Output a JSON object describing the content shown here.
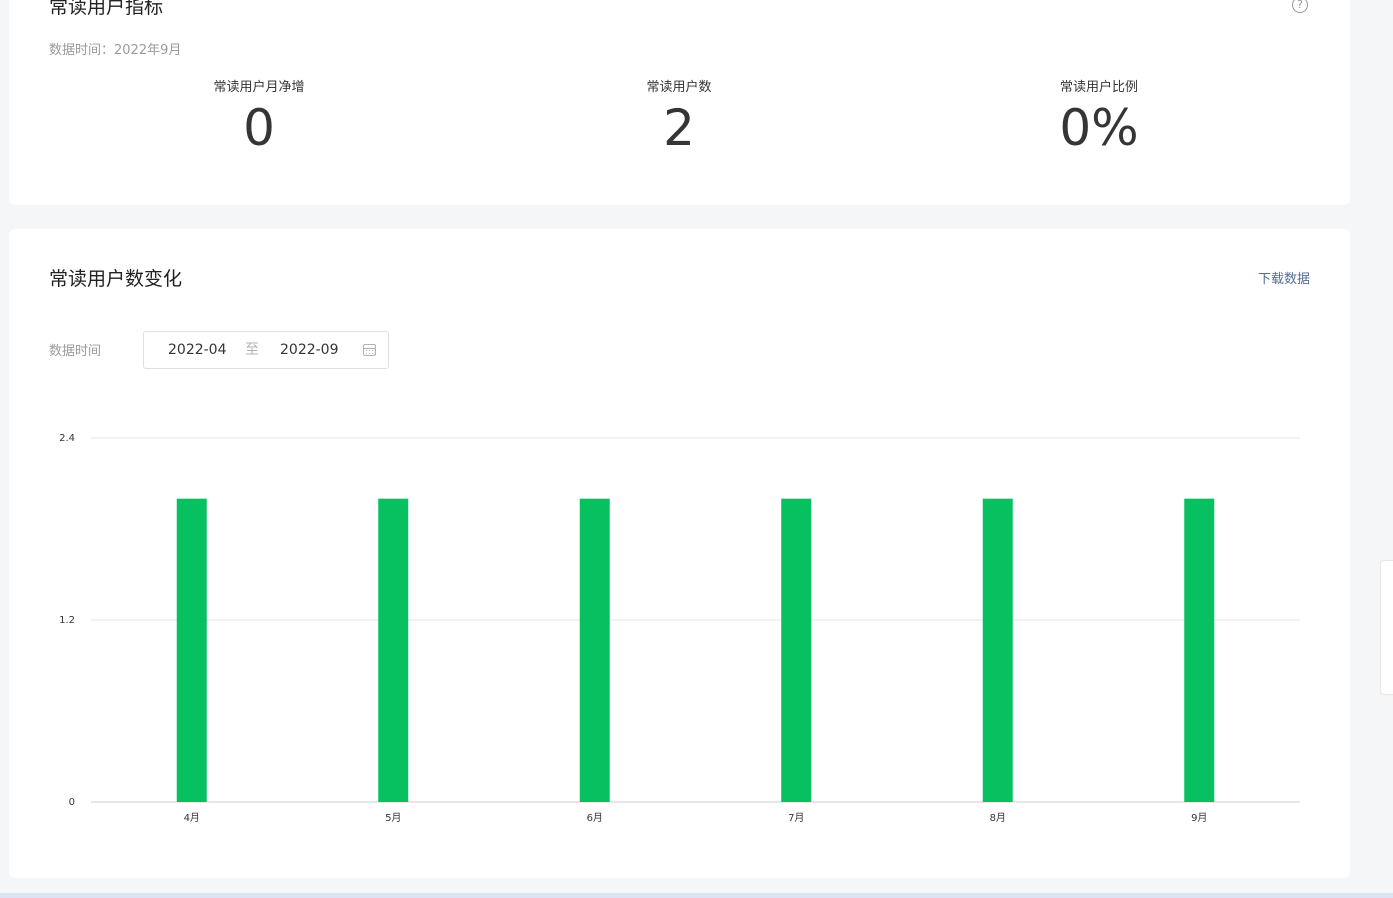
{
  "metrics": {
    "title": "常读用户指标",
    "help_glyph": "?",
    "data_time": "数据时间：2022年9月",
    "items": [
      {
        "label": "常读用户月净增",
        "value": "0"
      },
      {
        "label": "常读用户数",
        "value": "2"
      },
      {
        "label": "常读用户比例",
        "value": "0%"
      }
    ]
  },
  "chart_section": {
    "title": "常读用户数变化",
    "download_label": "下载数据",
    "filter_label": "数据时间",
    "date_start": "2022-04",
    "date_separator": "至",
    "date_end": "2022-09"
  },
  "colors": {
    "bar": "#07c160",
    "link": "#576b95"
  },
  "chart_data": {
    "type": "bar",
    "categories": [
      "4月",
      "5月",
      "6月",
      "7月",
      "8月",
      "9月"
    ],
    "values": [
      2,
      2,
      2,
      2,
      2,
      2
    ],
    "title": "",
    "xlabel": "",
    "ylabel": "",
    "ylim": [
      0,
      2.4
    ],
    "yticks": [
      "0",
      "1.2",
      "2.4"
    ],
    "grid": true
  }
}
